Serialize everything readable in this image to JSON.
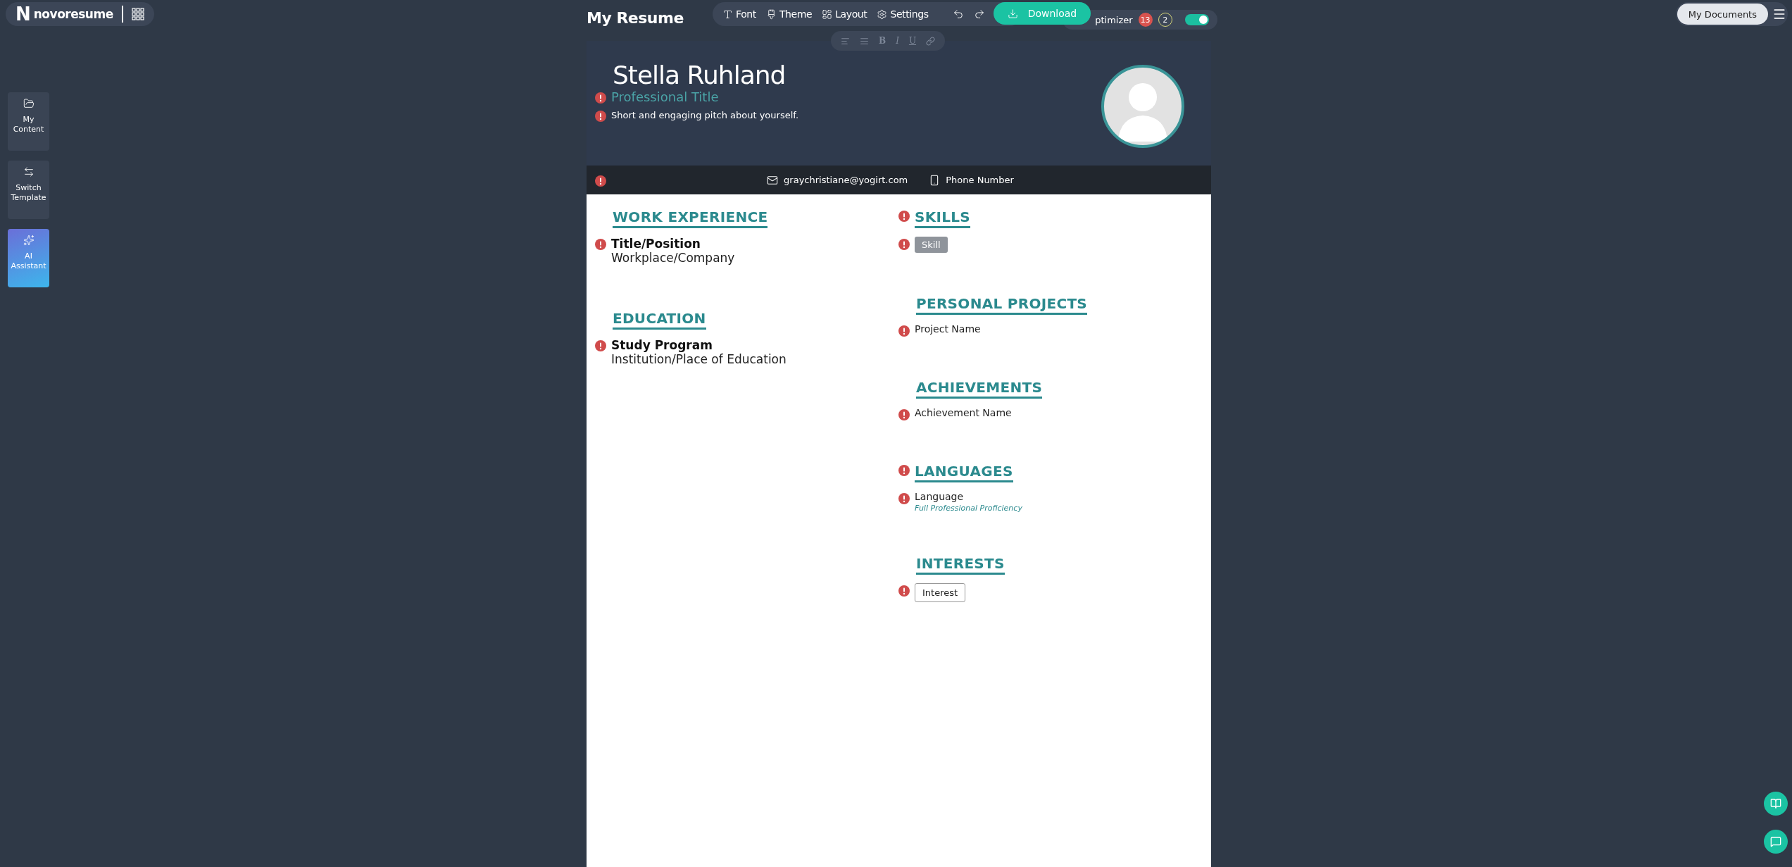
{
  "logo": {
    "mark": "N",
    "name": "novoresume"
  },
  "sidebar": [
    {
      "label": "My Content",
      "kind": "content"
    },
    {
      "label": "Switch Template",
      "kind": "template"
    },
    {
      "label": "AI Assistant",
      "kind": "ai"
    }
  ],
  "document_title": "My Resume",
  "toolbar": [
    {
      "kind": "font",
      "label": "Font"
    },
    {
      "kind": "theme",
      "label": "Theme"
    },
    {
      "kind": "layout",
      "label": "Layout"
    },
    {
      "kind": "settings",
      "label": "Settings"
    }
  ],
  "history": [
    {
      "kind": "undo"
    },
    {
      "kind": "redo"
    }
  ],
  "download": "Download",
  "optimizer": {
    "label": "ptimizer",
    "errors": "13",
    "warnings": "2",
    "on": true
  },
  "format_toolbar": [
    {
      "kind": "align-left",
      "disabled": true
    },
    {
      "kind": "justify",
      "disabled": true
    },
    {
      "kind": "bold",
      "label": "B",
      "disabled": true
    },
    {
      "kind": "italic",
      "label": "I",
      "disabled": true
    },
    {
      "kind": "underline",
      "label": "U",
      "disabled": true
    },
    {
      "kind": "link",
      "disabled": true
    }
  ],
  "my_documents": "My Documents",
  "resume": {
    "name": "Stella Ruhland",
    "title": "Professional Title",
    "title_warning": true,
    "pitch": "Short and engaging pitch about yourself.",
    "pitch_warning": true,
    "contact_warning": true,
    "contacts": [
      {
        "kind": "email",
        "text": "graychristiane@yogirt.com"
      },
      {
        "kind": "phone",
        "text": "Phone Number"
      }
    ],
    "left_sections": [
      {
        "heading": "WORK EXPERIENCE",
        "warning": false,
        "entries": [
          {
            "kind": "position",
            "title": "Title/Position",
            "subtitle": "Workplace/Company",
            "warning": true
          }
        ]
      },
      {
        "heading": "EDUCATION",
        "warning": false,
        "entries": [
          {
            "kind": "position",
            "title": "Study Program",
            "subtitle": "Institution/Place of Education",
            "warning": true
          }
        ]
      }
    ],
    "right_sections": [
      {
        "heading": "SKILLS",
        "warning": true,
        "entries": [
          {
            "kind": "chip",
            "title": "Skill",
            "warning": true
          }
        ]
      },
      {
        "heading": "PERSONAL PROJECTS",
        "warning": false,
        "entries": [
          {
            "kind": "line",
            "title": "Project Name",
            "warning": true
          }
        ]
      },
      {
        "heading": "ACHIEVEMENTS",
        "warning": false,
        "entries": [
          {
            "kind": "line",
            "title": "Achievement Name",
            "warning": true
          }
        ]
      },
      {
        "heading": "LANGUAGES",
        "warning": true,
        "entries": [
          {
            "kind": "language",
            "title": "Language",
            "subtitle": "Full Professional Proficiency",
            "warning": true
          }
        ]
      },
      {
        "heading": "INTERESTS",
        "warning": false,
        "entries": [
          {
            "kind": "tag",
            "title": "Interest",
            "warning": true
          }
        ]
      }
    ]
  },
  "floating": [
    {
      "kind": "guide"
    },
    {
      "kind": "chat"
    }
  ]
}
